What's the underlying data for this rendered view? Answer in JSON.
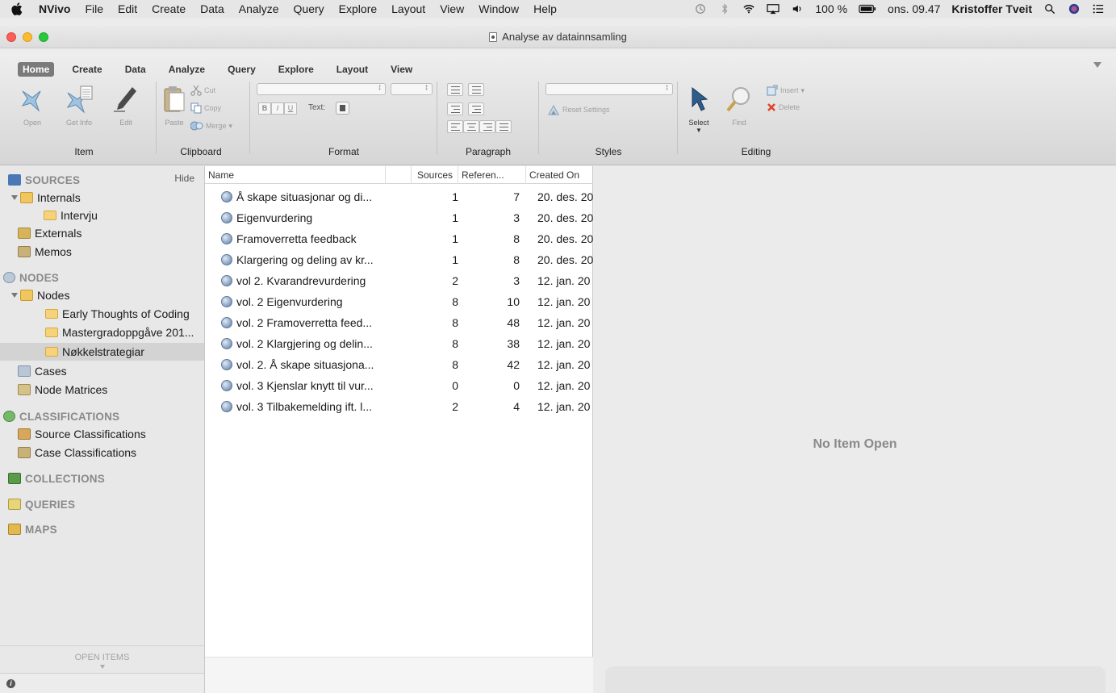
{
  "menubar": {
    "app": "NVivo",
    "items": [
      "File",
      "Edit",
      "Create",
      "Data",
      "Analyze",
      "Query",
      "Explore",
      "Layout",
      "View",
      "Window",
      "Help"
    ],
    "battery": "100 %",
    "clock": "ons. 09.47",
    "user": "Kristoffer Tveit"
  },
  "window": {
    "title": "Analyse av datainnsamling"
  },
  "ribbon": {
    "tabs": [
      "Home",
      "Create",
      "Data",
      "Analyze",
      "Query",
      "Explore",
      "Layout",
      "View"
    ],
    "item": {
      "label": "Item",
      "open": "Open",
      "get_info": "Get Info",
      "edit": "Edit"
    },
    "clipboard": {
      "label": "Clipboard",
      "paste": "Paste",
      "cut": "Cut",
      "copy": "Copy",
      "merge": "Merge"
    },
    "format": {
      "label": "Format",
      "bold": "B",
      "italic": "I",
      "underline": "U",
      "text": "Text:"
    },
    "paragraph": {
      "label": "Paragraph"
    },
    "styles": {
      "label": "Styles",
      "reset": "Reset Settings"
    },
    "editing": {
      "label": "Editing",
      "select": "Select",
      "find": "Find",
      "insert": "Insert",
      "delete": "Delete"
    }
  },
  "sidebar": {
    "hide": "Hide",
    "sources": "SOURCES",
    "internals": "Internals",
    "intervju": "Intervju",
    "externals": "Externals",
    "memos": "Memos",
    "nodes_head": "NODES",
    "nodes": "Nodes",
    "node_folders": [
      "Early Thoughts of Coding",
      "Mastergradoppgåve 201...",
      "Nøkkelstrategiar"
    ],
    "cases": "Cases",
    "node_matrices": "Node Matrices",
    "classifications": "CLASSIFICATIONS",
    "source_classifications": "Source Classifications",
    "case_classifications": "Case Classifications",
    "collections": "COLLECTIONS",
    "queries": "QUERIES",
    "maps": "MAPS",
    "open_items": "OPEN ITEMS"
  },
  "list": {
    "columns": [
      "Name",
      "Sources",
      "Referen...",
      "Created On"
    ],
    "rows": [
      {
        "name": "Å skape situasjonar og di...",
        "sources": "1",
        "refs": "7",
        "created": "20. des. 20"
      },
      {
        "name": "Eigenvurdering",
        "sources": "1",
        "refs": "3",
        "created": "20. des. 20"
      },
      {
        "name": "Framoverretta feedback",
        "sources": "1",
        "refs": "8",
        "created": "20. des. 20"
      },
      {
        "name": "Klargering og deling av kr...",
        "sources": "1",
        "refs": "8",
        "created": "20. des. 20"
      },
      {
        "name": "vol 2. Kvarandrevurdering",
        "sources": "2",
        "refs": "3",
        "created": "12. jan. 20"
      },
      {
        "name": "vol. 2 Eigenvurdering",
        "sources": "8",
        "refs": "10",
        "created": "12. jan. 20"
      },
      {
        "name": "vol. 2 Framoverretta feed...",
        "sources": "8",
        "refs": "48",
        "created": "12. jan. 20"
      },
      {
        "name": "vol. 2 Klargjering og delin...",
        "sources": "8",
        "refs": "38",
        "created": "12. jan. 20"
      },
      {
        "name": "vol. 2. Å skape situasjona...",
        "sources": "8",
        "refs": "42",
        "created": "12. jan. 20"
      },
      {
        "name": "vol. 3 Kjenslar knytt til vur...",
        "sources": "0",
        "refs": "0",
        "created": "12. jan. 20"
      },
      {
        "name": "vol. 3 Tilbakemelding ift. l...",
        "sources": "2",
        "refs": "4",
        "created": "12. jan. 20"
      }
    ]
  },
  "detail": {
    "empty": "No Item Open"
  }
}
